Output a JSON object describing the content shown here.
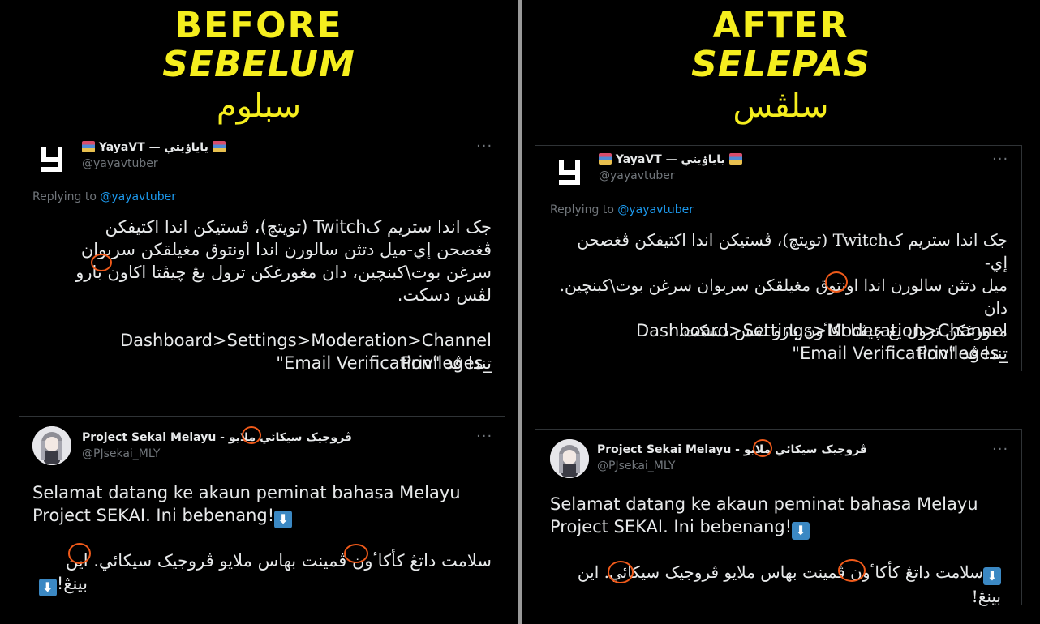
{
  "left": {
    "heading_en": "BEFORE",
    "heading_ms": "SEBELUM",
    "heading_jawi": "سبلوم",
    "tweet1": {
      "name": "YayaVT — ياياۏيتي",
      "handle": "@yayavtuber",
      "more": "···",
      "reply_prefix": "Replying to",
      "reply_handle": "@yayavtuber",
      "jawi_lines": [
        "جک اندا ستريم کTwitch (تويتچ)، ڤستيکن اندا اکتيفکن",
        "ڤغصحن إي-ميل دتثن سالورن اندا اونتوق مغيلقکن سربوان",
        "سرغن بوت\\کبنچين، دان مغورغکن ترول يڠ چيڤتا اکاون بارو",
        "لڤس دسکت."
      ],
      "path_line": "Dashboard>Settings>Moderation>Channel Privileges_",
      "email_line": "تندا ڤد \"Email Verification\""
    },
    "tweet2": {
      "name": "Project Sekai Melayu - ڤروجيک سيکائي ملايو",
      "handle": "@PJsekai_MLY",
      "more": "···",
      "line1": "Selamat datang ke akaun peminat bahasa Melayu",
      "line2": "Project SEKAI. Ini bebenang!",
      "jawi1": "سلامت داتڠ کأکاٴون ڤمينت بهاس ملايو ڤروجيک سيکائي. اين",
      "jawi2": "بينڠ!",
      "arrow": "⬇"
    }
  },
  "right": {
    "heading_en": "AFTER",
    "heading_ms": "SELEPAS",
    "heading_jawi": "سلڤس",
    "tweet1": {
      "name": "YayaVT — ياياۏيتي",
      "handle": "@yayavtuber",
      "more": "···",
      "reply_prefix": "Replying to",
      "reply_handle": "@yayavtuber",
      "jawi_lines": [
        "جک اندا ستريم کTwitch (تويتچ)، ڤستيکن اندا اکتيفکن ڤغصحن إي-",
        "ميل دتثن سالورن اندا اونتوق مغيلقکن سربوان سرغن بوت\\کبنچين. دان",
        "مغورغکن ترول يڠ چيڤتا اکاٴون بارو لڤس دسکت."
      ],
      "path_line": "Dashboard>Settings>Moderation>Channel Privileges_",
      "email_line": "تندا ڤد \"Email Verification\""
    },
    "tweet2": {
      "name": "Project Sekai Melayu - ڤروجيک سيکائي ملايو",
      "handle": "@PJsekai_MLY",
      "more": "···",
      "line1": "Selamat datang ke akaun peminat bahasa Melayu",
      "line2": "Project SEKAI. Ini bebenang!",
      "jawi1": "سلامت داتڠ کأکاٴون ڤمينت بهاس ملايو ڤروجيک سيکائي. اين بينڠ!",
      "arrow": "⬇"
    }
  },
  "colors": {
    "heading": "#f5ee1e",
    "highlight_ring": "#f05a1a",
    "link": "#1d9bf0",
    "muted": "#71767b",
    "text": "#e7e9ea"
  }
}
